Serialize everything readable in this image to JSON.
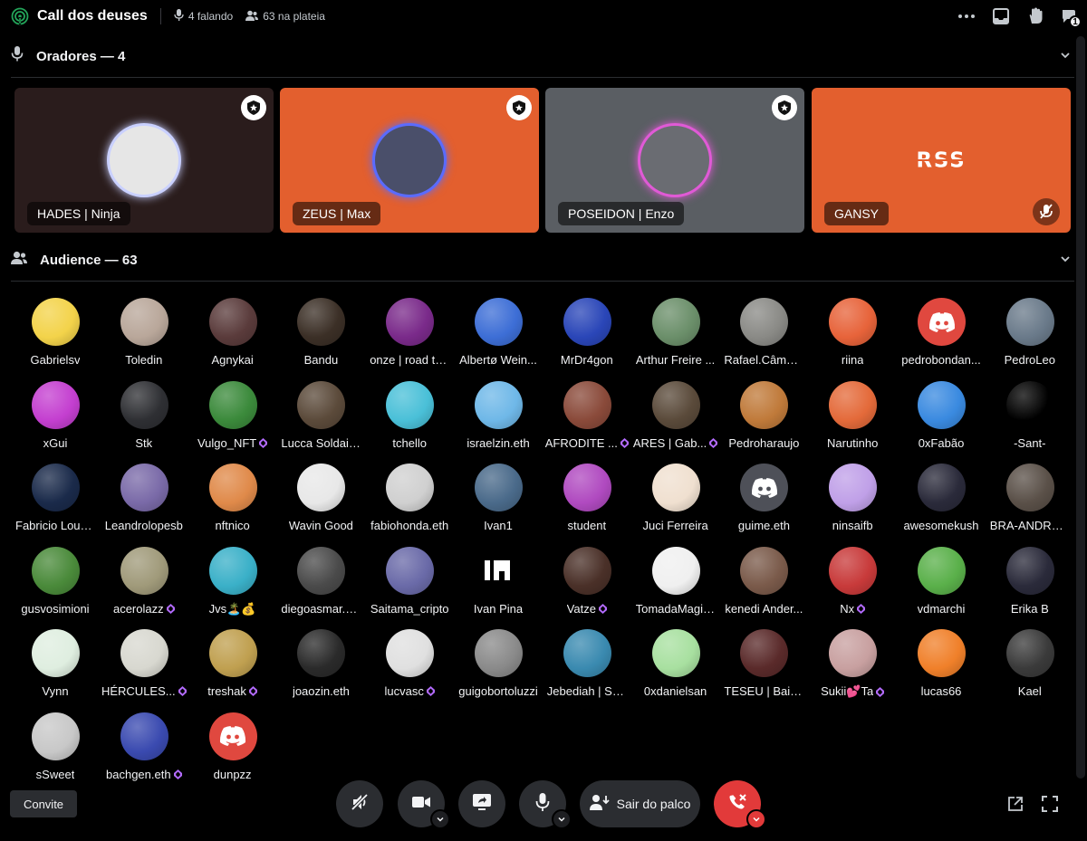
{
  "header": {
    "title": "Call dos deuses",
    "speaking": "4 falando",
    "audience_count": "63 na plateia",
    "notification_count": "1"
  },
  "speakers_section": {
    "label": "Oradores — 4"
  },
  "speakers": [
    {
      "name": "HADES | Ninja",
      "bg": "#2a1c1c",
      "ring": "#c9d0ff",
      "av": "#e6e6e6",
      "moderator": true,
      "muted": false
    },
    {
      "name": "ZEUS | Max",
      "bg": "#e35f2e",
      "ring": "#5a6bff",
      "av": "#4a4f6a",
      "moderator": true,
      "muted": false
    },
    {
      "name": "POSEIDON | Enzo",
      "bg": "#5a5e63",
      "ring": "#e05ad6",
      "av": "#6a6c72",
      "moderator": true,
      "muted": false
    },
    {
      "name": "GANSY",
      "bg": "#e35f2e",
      "ring": "",
      "av": "",
      "moderator": false,
      "muted": true,
      "logo": "RSS"
    }
  ],
  "audience_section": {
    "label": "Audience — 63"
  },
  "audience": [
    {
      "name": "Gabrielsv",
      "c": "#f3d34a",
      "gem": false
    },
    {
      "name": "Toledin",
      "c": "#b9a79a",
      "gem": false
    },
    {
      "name": "Agnykai",
      "c": "#5a3b3b",
      "gem": false
    },
    {
      "name": "Bandu",
      "c": "#3b2f26",
      "gem": false
    },
    {
      "name": "onze | road to ...",
      "c": "#7a2a8a",
      "gem": false
    },
    {
      "name": "Albertø Wein...",
      "c": "#3d6ed6",
      "gem": false
    },
    {
      "name": "MrDr4gon",
      "c": "#2a46b8",
      "gem": false
    },
    {
      "name": "Arthur Freire ...",
      "c": "#6b8f6a",
      "gem": false
    },
    {
      "name": "Rafael.Câmar...",
      "c": "#8a8a86",
      "gem": false
    },
    {
      "name": "riina",
      "c": "#e7633a",
      "gem": false
    },
    {
      "name": "pedrobondan...",
      "c": "#e0483f",
      "gem": false,
      "discord": true
    },
    {
      "name": "PedroLeo",
      "c": "#6a7a8a",
      "gem": false
    },
    {
      "name": "xGui",
      "c": "#c43fd0",
      "gem": false
    },
    {
      "name": "Stk",
      "c": "#2e2f33",
      "gem": false
    },
    {
      "name": "Vulgo_NFT",
      "c": "#3b8a3b",
      "gem": true
    },
    {
      "name": "Lucca Soldain...",
      "c": "#5b4a3a",
      "gem": false
    },
    {
      "name": "tchello",
      "c": "#4ac0d8",
      "gem": false
    },
    {
      "name": "israelzin.eth",
      "c": "#6fb8e8",
      "gem": false
    },
    {
      "name": "AFRODITE ...",
      "c": "#8a4a3a",
      "gem": true
    },
    {
      "name": "ARES | Gab...",
      "c": "#5a4a3a",
      "gem": true
    },
    {
      "name": "Pedroharaujo",
      "c": "#c07a3a",
      "gem": false
    },
    {
      "name": "Narutinho",
      "c": "#e46a3a",
      "gem": false
    },
    {
      "name": "0xFabão",
      "c": "#3a8ae0",
      "gem": false
    },
    {
      "name": "-Sant-",
      "c": "#000000",
      "gem": false
    },
    {
      "name": "Fabricio Loures",
      "c": "#1a2a4a",
      "gem": false
    },
    {
      "name": "Leandrolopesb",
      "c": "#7a6aa8",
      "gem": false
    },
    {
      "name": "nftnico",
      "c": "#e08a4a",
      "gem": false
    },
    {
      "name": "Wavin Good",
      "c": "#e8e8e8",
      "gem": false
    },
    {
      "name": "fabiohonda.eth",
      "c": "#d0d0d0",
      "gem": false
    },
    {
      "name": "Ivan1",
      "c": "#4a6a8a",
      "gem": false
    },
    {
      "name": "student",
      "c": "#b04ac0",
      "gem": false
    },
    {
      "name": "Juci Ferreira",
      "c": "#f0e0d0",
      "gem": false
    },
    {
      "name": "guime.eth",
      "c": "#4e5058",
      "gem": false,
      "discord": true
    },
    {
      "name": "ninsaifb",
      "c": "#c0a0e8",
      "gem": false
    },
    {
      "name": "awesomekush",
      "c": "#2a2a3a",
      "gem": false
    },
    {
      "name": "BRA-ANDRADE",
      "c": "#5a5048",
      "gem": false
    },
    {
      "name": "gusvosimioni",
      "c": "#4a8a3a",
      "gem": false
    },
    {
      "name": "acerolazz",
      "c": "#a09a7a",
      "gem": true
    },
    {
      "name": "Jvs🏝️💰",
      "c": "#3ab0c8",
      "gem": false
    },
    {
      "name": "diegoasmar.eth",
      "c": "#4a4a4a",
      "gem": false
    },
    {
      "name": "Saitama_cripto",
      "c": "#6a6aa8",
      "gem": false
    },
    {
      "name": "Ivan Pina",
      "c": "#000000",
      "gem": false,
      "ip": true
    },
    {
      "name": "Vatze",
      "c": "#4a3028",
      "gem": true
    },
    {
      "name": "TomadaMagica",
      "c": "#f0f0f0",
      "gem": false
    },
    {
      "name": "kenedi Ander...",
      "c": "#7a5a4a",
      "gem": false
    },
    {
      "name": "Nx",
      "c": "#c83a3a",
      "gem": true
    },
    {
      "name": "vdmarchi",
      "c": "#5ab04a",
      "gem": false
    },
    {
      "name": "Erika B",
      "c": "#2a2a3a",
      "gem": false
    },
    {
      "name": "Vynn",
      "c": "#dfeee0",
      "gem": false
    },
    {
      "name": "HÉRCULES...",
      "c": "#d8d8d0",
      "gem": true
    },
    {
      "name": "treshak",
      "c": "#c0a050",
      "gem": true
    },
    {
      "name": "joaozin.eth",
      "c": "#2a2a2a",
      "gem": false
    },
    {
      "name": "lucvasc",
      "c": "#e0e0e0",
      "gem": true
    },
    {
      "name": "guigobortoluzzi",
      "c": "#8a8a8a",
      "gem": false
    },
    {
      "name": "Jebediah | Sui...",
      "c": "#3a8ab0",
      "gem": false
    },
    {
      "name": "0xdanielsan",
      "c": "#a8e0a0",
      "gem": false
    },
    {
      "name": "TESEU | Baixo...",
      "c": "#5a2a2a",
      "gem": false
    },
    {
      "name": "Sukii💕Ta",
      "c": "#c8a0a0",
      "gem": true
    },
    {
      "name": "lucas66",
      "c": "#f0802a",
      "gem": false
    },
    {
      "name": "Kael",
      "c": "#3a3a3a",
      "gem": false
    },
    {
      "name": "sSweet",
      "c": "#c8c8c8",
      "gem": false
    },
    {
      "name": "bachgen.eth",
      "c": "#3a4ab0",
      "gem": true
    },
    {
      "name": "dunpzz",
      "c": "#e0483f",
      "gem": false,
      "discord": true
    }
  ],
  "footer": {
    "invite_label": "Convite",
    "leave_stage_label": "Sair do palco"
  },
  "colors": {
    "background": "#000000",
    "control": "#2b2d31",
    "end_call": "#e23a3a",
    "gem": "#b36bff",
    "stage_icon": "#23a55a"
  }
}
